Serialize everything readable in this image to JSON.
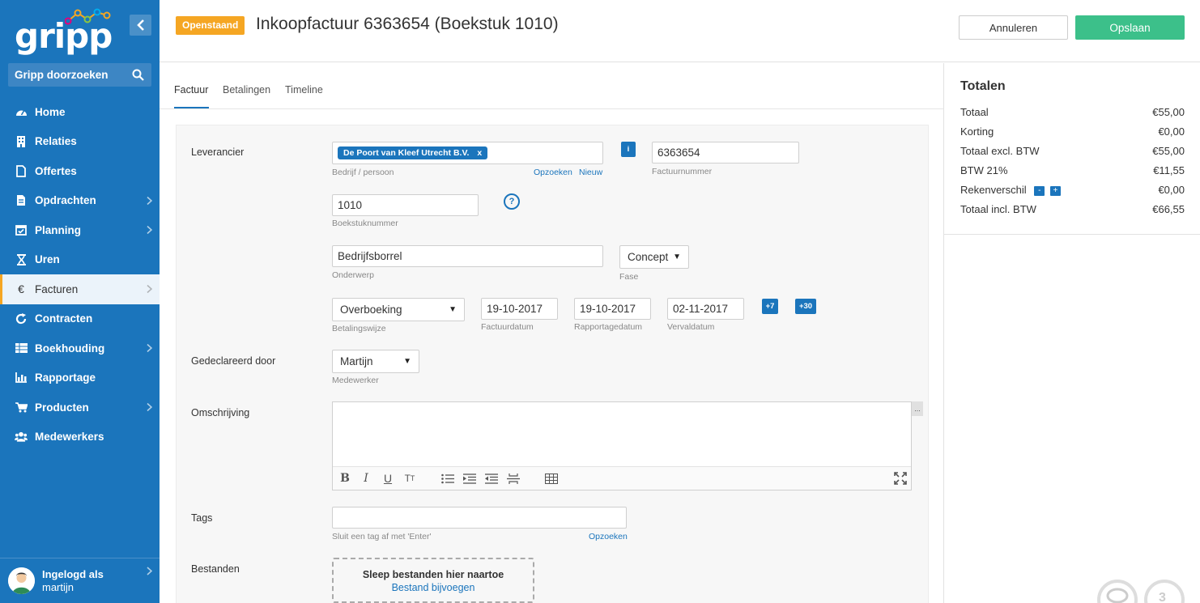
{
  "sidebar": {
    "logo": "gripp",
    "search_placeholder": "Gripp doorzoeken",
    "items": [
      {
        "label": "Home",
        "icon": "dashboard-icon",
        "has_chevron": false
      },
      {
        "label": "Relaties",
        "icon": "building-icon",
        "has_chevron": false
      },
      {
        "label": "Offertes",
        "icon": "document-icon",
        "has_chevron": false
      },
      {
        "label": "Opdrachten",
        "icon": "file-list-icon",
        "has_chevron": true
      },
      {
        "label": "Planning",
        "icon": "calendar-icon",
        "has_chevron": true
      },
      {
        "label": "Uren",
        "icon": "hourglass-icon",
        "has_chevron": false
      },
      {
        "label": "Facturen",
        "icon": "euro-icon",
        "has_chevron": true,
        "active": true
      },
      {
        "label": "Contracten",
        "icon": "refresh-icon",
        "has_chevron": false
      },
      {
        "label": "Boekhouding",
        "icon": "ledger-icon",
        "has_chevron": true
      },
      {
        "label": "Rapportage",
        "icon": "bar-chart-icon",
        "has_chevron": false
      },
      {
        "label": "Producten",
        "icon": "cart-icon",
        "has_chevron": true
      },
      {
        "label": "Medewerkers",
        "icon": "users-icon",
        "has_chevron": false
      }
    ],
    "login": {
      "line1": "Ingelogd als",
      "line2": "martijn"
    }
  },
  "header": {
    "status_badge": "Openstaand",
    "title": "Inkoopfactuur 6363654 (Boekstuk 1010)",
    "cancel_label": "Annuleren",
    "save_label": "Opslaan"
  },
  "tabs": [
    {
      "label": "Factuur",
      "active": true
    },
    {
      "label": "Betalingen",
      "active": false
    },
    {
      "label": "Timeline",
      "active": false
    }
  ],
  "form": {
    "leverancier_label": "Leverancier",
    "supplier_tag": "De Poort van Kleef Utrecht B.V.",
    "supplier_tag_remove": "x",
    "supplier_hint": "Bedrijf / persoon",
    "supplier_link_search": "Opzoeken",
    "supplier_link_new": "Nieuw",
    "info_button": "i",
    "invoice_number": "6363654",
    "invoice_number_hint": "Factuurnummer",
    "booking_number": "1010",
    "booking_number_hint": "Boekstuknummer",
    "help_button": "?",
    "subject": "Bedrijfsborrel",
    "subject_hint": "Onderwerp",
    "phase": "Concept",
    "phase_hint": "Fase",
    "payment_method": "Overboeking",
    "payment_method_hint": "Betalingswijze",
    "invoice_date": "19-10-2017",
    "invoice_date_hint": "Factuurdatum",
    "report_date": "19-10-2017",
    "report_date_hint": "Rapportagedatum",
    "due_date": "02-11-2017",
    "due_date_hint": "Vervaldatum",
    "plus7": "+7",
    "plus30": "+30",
    "declared_by_label": "Gedeclareerd door",
    "declared_by": "Martijn",
    "declared_by_hint": "Medewerker",
    "description_label": "Omschrijving",
    "description_value": "",
    "editor_more": "...",
    "tags_label": "Tags",
    "tags_value": "",
    "tags_hint": "Sluit een tag af met 'Enter'",
    "tags_link": "Opzoeken",
    "files_label": "Bestanden",
    "dropzone_title": "Sleep bestanden hier naartoe",
    "dropzone_link": "Bestand bijvoegen"
  },
  "totals": {
    "title": "Totalen",
    "rows": [
      {
        "label": "Totaal",
        "value": "€55,00"
      },
      {
        "label": "Korting",
        "value": "€0,00"
      },
      {
        "label": "Totaal excl. BTW",
        "value": "€55,00"
      },
      {
        "label": "BTW 21%",
        "value": "€11,55"
      },
      {
        "label": "Rekenverschil",
        "value": "€0,00"
      },
      {
        "label": "Totaal incl. BTW",
        "value": "€66,55"
      }
    ],
    "minus": "-",
    "plus": "+"
  },
  "widgets": {
    "badge_count": "3"
  },
  "colors": {
    "brand": "#1b75bc",
    "accent": "#f5a623",
    "save": "#3cc08a"
  }
}
